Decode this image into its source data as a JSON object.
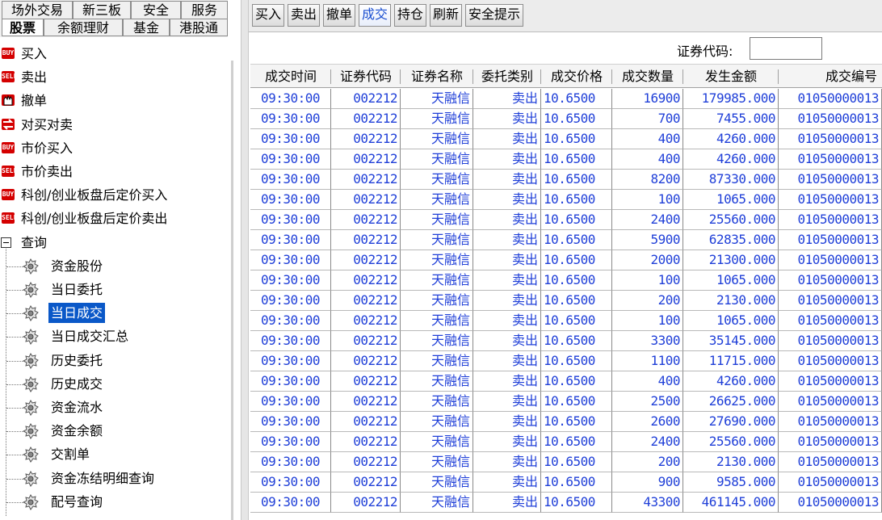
{
  "top_tabs": {
    "row1": [
      "场外交易",
      "新三板",
      "安全",
      "服务"
    ],
    "row2": [
      "股票",
      "余额理财",
      "基金",
      "港股通"
    ],
    "active": "股票"
  },
  "tree": {
    "items": [
      {
        "label": "买入",
        "icon": "buy-icon",
        "badge": "BUY"
      },
      {
        "label": "卖出",
        "icon": "sell-icon",
        "badge": "SELL"
      },
      {
        "label": "撤单",
        "icon": "cancel-hand-icon",
        "badge": ""
      },
      {
        "label": "对买对卖",
        "icon": "swap-icon",
        "badge": ""
      },
      {
        "label": "市价买入",
        "icon": "buy-icon",
        "badge": "BUY"
      },
      {
        "label": "市价卖出",
        "icon": "sell-icon",
        "badge": "SELL"
      },
      {
        "label": "科创/创业板盘后定价买入",
        "icon": "buy-icon",
        "badge": "BUY"
      },
      {
        "label": "科创/创业板盘后定价卖出",
        "icon": "sell-icon",
        "badge": "SELL"
      }
    ],
    "query_label": "查询",
    "query_items": [
      "资金股份",
      "当日委托",
      "当日成交",
      "当日成交汇总",
      "历史委托",
      "历史成交",
      "资金流水",
      "资金余额",
      "交割单",
      "资金冻结明细查询",
      "配号查询"
    ],
    "selected": "当日成交"
  },
  "toolbar": {
    "buttons": [
      "买入",
      "卖出",
      "撤单",
      "成交",
      "持仓",
      "刷新",
      "安全提示"
    ],
    "active": "成交"
  },
  "search": {
    "label": "证券代码:",
    "value": ""
  },
  "table": {
    "headers": [
      "成交时间",
      "证券代码",
      "证券名称",
      "委托类别",
      "成交价格",
      "成交数量",
      "发生金额",
      "成交编号"
    ],
    "rows": [
      [
        "09:30:00",
        "002212",
        "天融信",
        "卖出",
        "10.6500",
        "16900",
        "179985.000",
        "01050000013"
      ],
      [
        "09:30:00",
        "002212",
        "天融信",
        "卖出",
        "10.6500",
        "700",
        "7455.000",
        "01050000013"
      ],
      [
        "09:30:00",
        "002212",
        "天融信",
        "卖出",
        "10.6500",
        "400",
        "4260.000",
        "01050000013"
      ],
      [
        "09:30:00",
        "002212",
        "天融信",
        "卖出",
        "10.6500",
        "400",
        "4260.000",
        "01050000013"
      ],
      [
        "09:30:00",
        "002212",
        "天融信",
        "卖出",
        "10.6500",
        "8200",
        "87330.000",
        "01050000013"
      ],
      [
        "09:30:00",
        "002212",
        "天融信",
        "卖出",
        "10.6500",
        "100",
        "1065.000",
        "01050000013"
      ],
      [
        "09:30:00",
        "002212",
        "天融信",
        "卖出",
        "10.6500",
        "2400",
        "25560.000",
        "01050000013"
      ],
      [
        "09:30:00",
        "002212",
        "天融信",
        "卖出",
        "10.6500",
        "5900",
        "62835.000",
        "01050000013"
      ],
      [
        "09:30:00",
        "002212",
        "天融信",
        "卖出",
        "10.6500",
        "2000",
        "21300.000",
        "01050000013"
      ],
      [
        "09:30:00",
        "002212",
        "天融信",
        "卖出",
        "10.6500",
        "100",
        "1065.000",
        "01050000013"
      ],
      [
        "09:30:00",
        "002212",
        "天融信",
        "卖出",
        "10.6500",
        "200",
        "2130.000",
        "01050000013"
      ],
      [
        "09:30:00",
        "002212",
        "天融信",
        "卖出",
        "10.6500",
        "100",
        "1065.000",
        "01050000013"
      ],
      [
        "09:30:00",
        "002212",
        "天融信",
        "卖出",
        "10.6500",
        "3300",
        "35145.000",
        "01050000013"
      ],
      [
        "09:30:00",
        "002212",
        "天融信",
        "卖出",
        "10.6500",
        "1100",
        "11715.000",
        "01050000013"
      ],
      [
        "09:30:00",
        "002212",
        "天融信",
        "卖出",
        "10.6500",
        "400",
        "4260.000",
        "01050000013"
      ],
      [
        "09:30:00",
        "002212",
        "天融信",
        "卖出",
        "10.6500",
        "2500",
        "26625.000",
        "01050000013"
      ],
      [
        "09:30:00",
        "002212",
        "天融信",
        "卖出",
        "10.6500",
        "2600",
        "27690.000",
        "01050000013"
      ],
      [
        "09:30:00",
        "002212",
        "天融信",
        "卖出",
        "10.6500",
        "2400",
        "25560.000",
        "01050000013"
      ],
      [
        "09:30:00",
        "002212",
        "天融信",
        "卖出",
        "10.6500",
        "200",
        "2130.000",
        "01050000013"
      ],
      [
        "09:30:00",
        "002212",
        "天融信",
        "卖出",
        "10.6500",
        "900",
        "9585.000",
        "01050000013"
      ],
      [
        "09:30:00",
        "002212",
        "天融信",
        "卖出",
        "10.6500",
        "43300",
        "461145.000",
        "01050000013"
      ]
    ]
  },
  "colors": {
    "cell_text": "#1f3fd8",
    "selection": "#0a58c8",
    "active_tab": "#1a4fd0",
    "order_icon": "#d40000"
  }
}
